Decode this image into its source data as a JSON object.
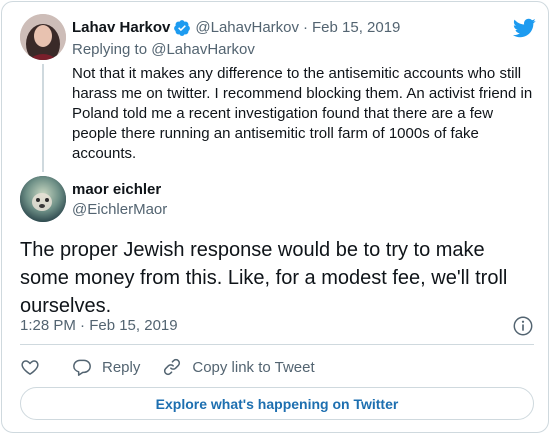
{
  "parent_tweet": {
    "author_name": "Lahav Harkov",
    "verified": true,
    "handle": "@LahavHarkov",
    "separator": "·",
    "date": "Feb 15, 2019",
    "replying_prefix": "Replying to",
    "replying_to": "@LahavHarkov",
    "text": "Not that it makes any difference to the antisemitic accounts who still harass me on twitter. I recommend blocking them. An activist friend in Poland told me a recent investigation found that there are a few people there running an antisemitic troll farm of 1000s of fake accounts."
  },
  "main_tweet": {
    "author_name": "maor eichler",
    "handle": "@EichlerMaor",
    "text": "The proper Jewish response would be to try to make some money from this. Like, for a modest fee, we'll troll ourselves.",
    "timestamp": "1:28 PM · Feb 15, 2019"
  },
  "actions": {
    "reply_label": "Reply",
    "copy_link_label": "Copy link to Tweet"
  },
  "explore_button": "Explore what's happening on Twitter",
  "colors": {
    "twitter_blue": "#1d9bf0",
    "text_primary": "#0f1419",
    "text_secondary": "#536471",
    "border": "#cfd9de",
    "explore_link": "#1d6fb0"
  },
  "icons": [
    "verified-badge-icon",
    "twitter-bird-icon",
    "info-icon",
    "heart-icon",
    "reply-icon",
    "link-icon"
  ]
}
